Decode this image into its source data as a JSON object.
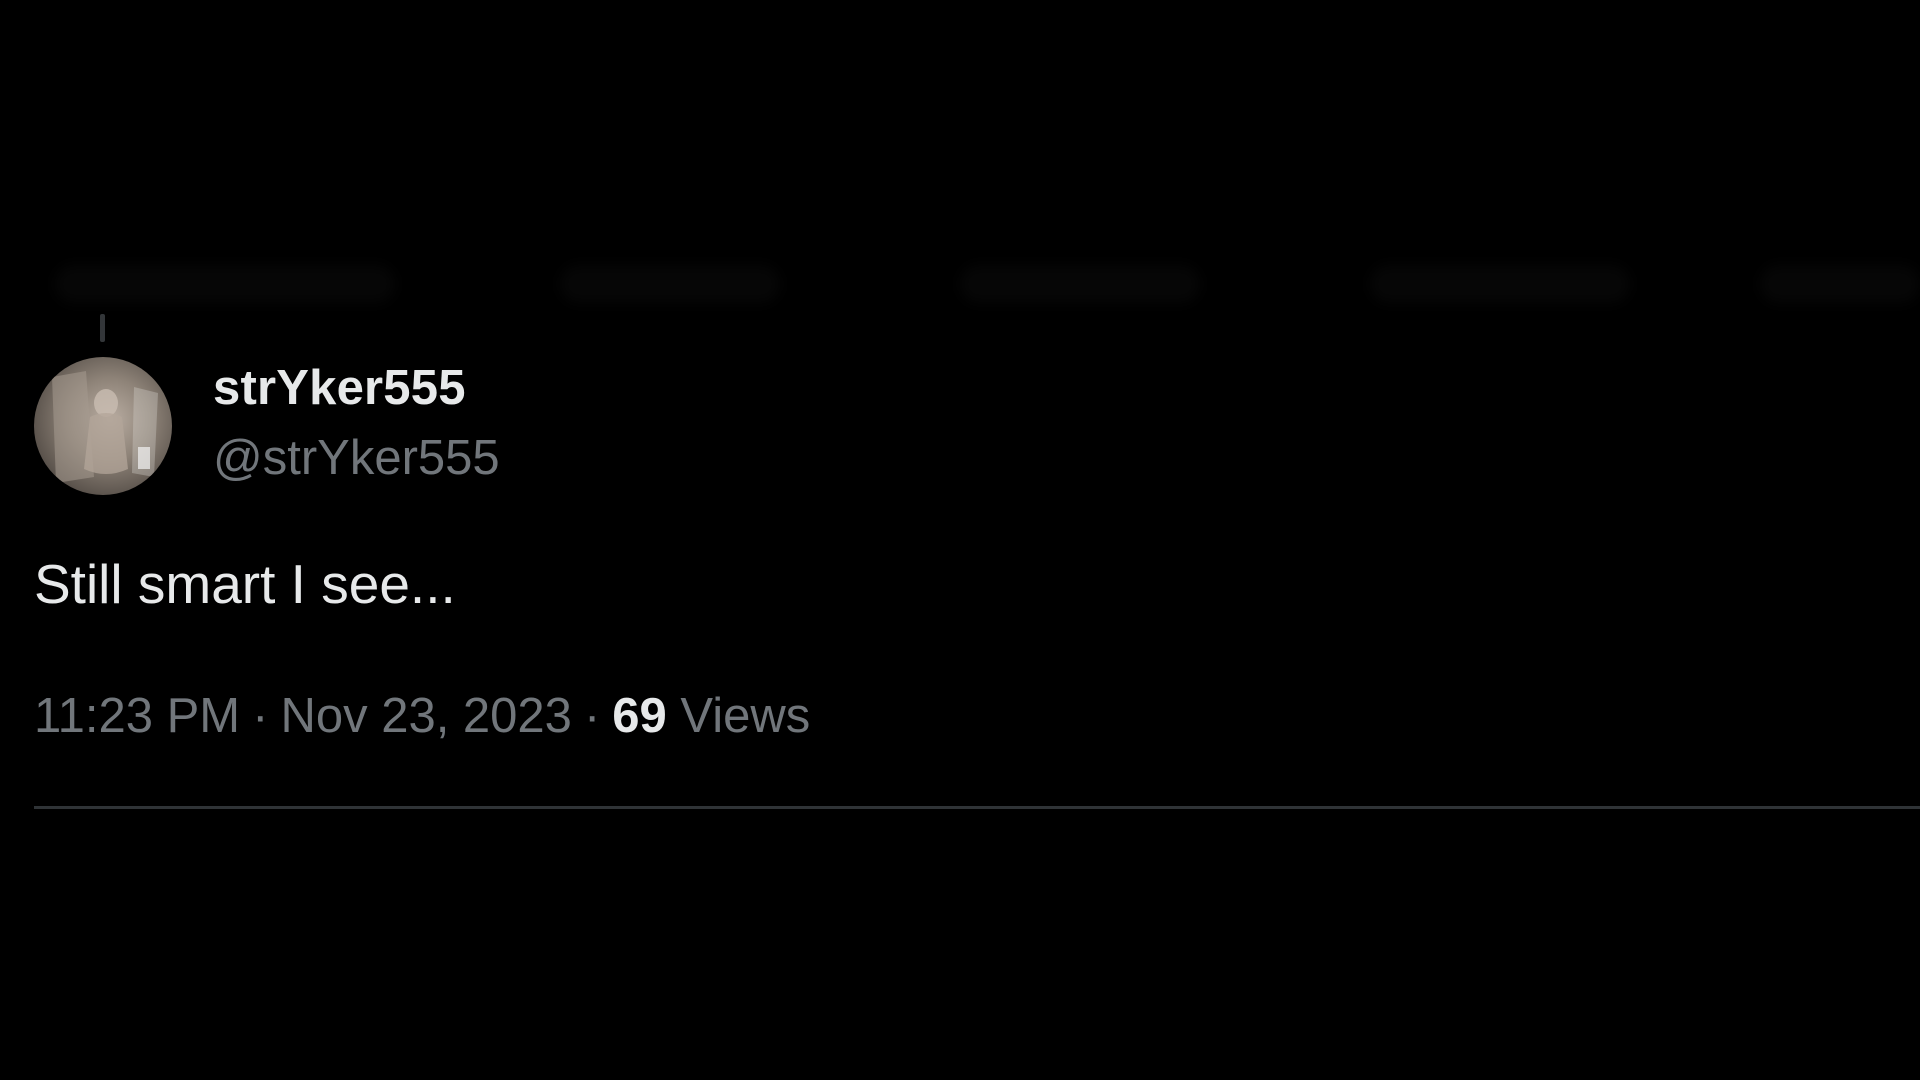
{
  "tweet": {
    "display_name": "strYker555",
    "handle": "@strYker555",
    "text": "Still smart I see...",
    "time": "11:23 PM",
    "separator": "·",
    "date": "Nov 23, 2023",
    "views_count": "69",
    "views_label": "Views"
  },
  "colors": {
    "background": "#000000",
    "primary_text": "#e7e9ea",
    "secondary_text": "#71767b",
    "divider": "#2f3336"
  },
  "icons": {
    "avatar": "profile-photo"
  }
}
